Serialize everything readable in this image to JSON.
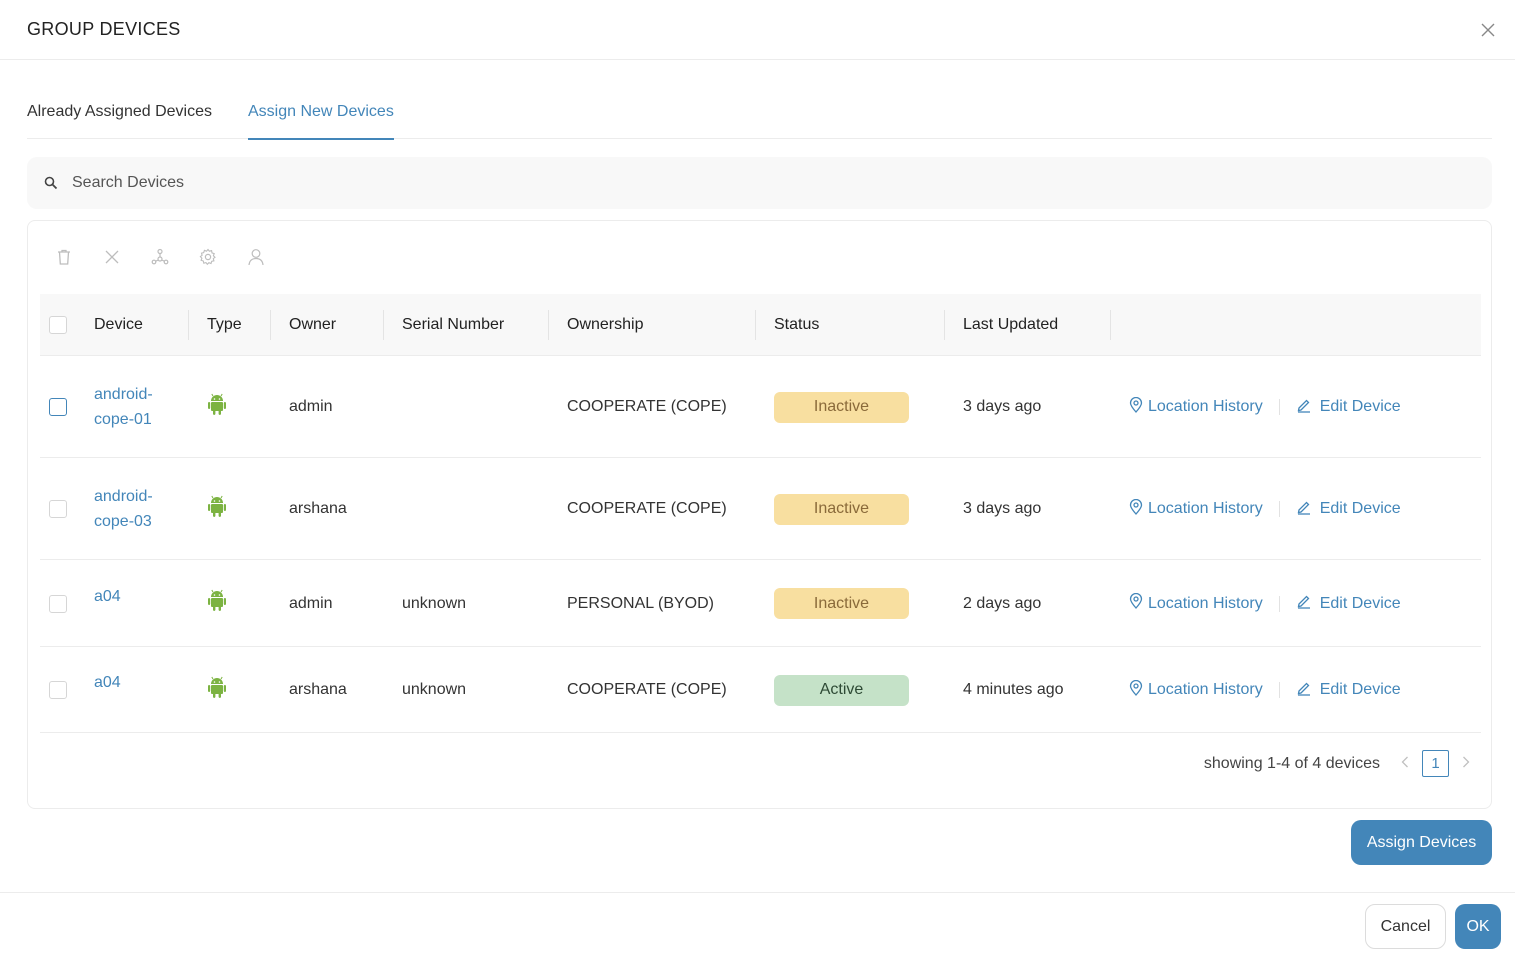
{
  "dialog": {
    "title": "GROUP DEVICES",
    "close_icon": "close-icon"
  },
  "tabs": [
    {
      "label": "Already Assigned Devices",
      "active": false
    },
    {
      "label": "Assign New Devices",
      "active": true
    }
  ],
  "search": {
    "placeholder": "Search Devices",
    "value": "",
    "icon": "search-icon"
  },
  "toolbar": {
    "icons": [
      "trash-icon",
      "close-icon",
      "share-network-icon",
      "gear-icon",
      "user-icon"
    ]
  },
  "table": {
    "columns": [
      "Device",
      "Type",
      "Owner",
      "Serial Number",
      "Ownership",
      "Status",
      "Last Updated"
    ],
    "rows": [
      {
        "device_line1": "android-",
        "device_line2": "cope-01",
        "type_icon": "android-icon",
        "owner": "admin",
        "serial": "",
        "ownership": "COOPERATE (COPE)",
        "status": "Inactive",
        "status_kind": "inactive",
        "last_updated": "3 days ago",
        "checkbox_focused": true
      },
      {
        "device_line1": "android-",
        "device_line2": "cope-03",
        "type_icon": "android-icon",
        "owner": "arshana",
        "serial": "",
        "ownership": "COOPERATE (COPE)",
        "status": "Inactive",
        "status_kind": "inactive",
        "last_updated": "3 days ago",
        "checkbox_focused": false
      },
      {
        "device_line1": "a04",
        "device_line2": "",
        "type_icon": "android-icon",
        "owner": "admin",
        "serial": "unknown",
        "ownership": "PERSONAL (BYOD)",
        "status": "Inactive",
        "status_kind": "inactive",
        "last_updated": "2 days ago",
        "checkbox_focused": false
      },
      {
        "device_line1": "a04",
        "device_line2": "",
        "type_icon": "android-icon",
        "owner": "arshana",
        "serial": "unknown",
        "ownership": "COOPERATE (COPE)",
        "status": "Active",
        "status_kind": "active",
        "last_updated": "4 minutes ago",
        "checkbox_focused": false
      }
    ],
    "row_actions": {
      "location_history": "Location History",
      "edit_device": "Edit Device"
    }
  },
  "pagination": {
    "summary": "showing 1-4 of 4 devices",
    "current_page": "1",
    "prev": "<",
    "next": ">"
  },
  "buttons": {
    "assign": "Assign Devices",
    "cancel": "Cancel",
    "ok": "OK"
  },
  "colors": {
    "accent": "#4386b9",
    "inactive_bg": "#f8dfa0",
    "active_bg": "#c5e2c8",
    "android": "#7cb342"
  }
}
